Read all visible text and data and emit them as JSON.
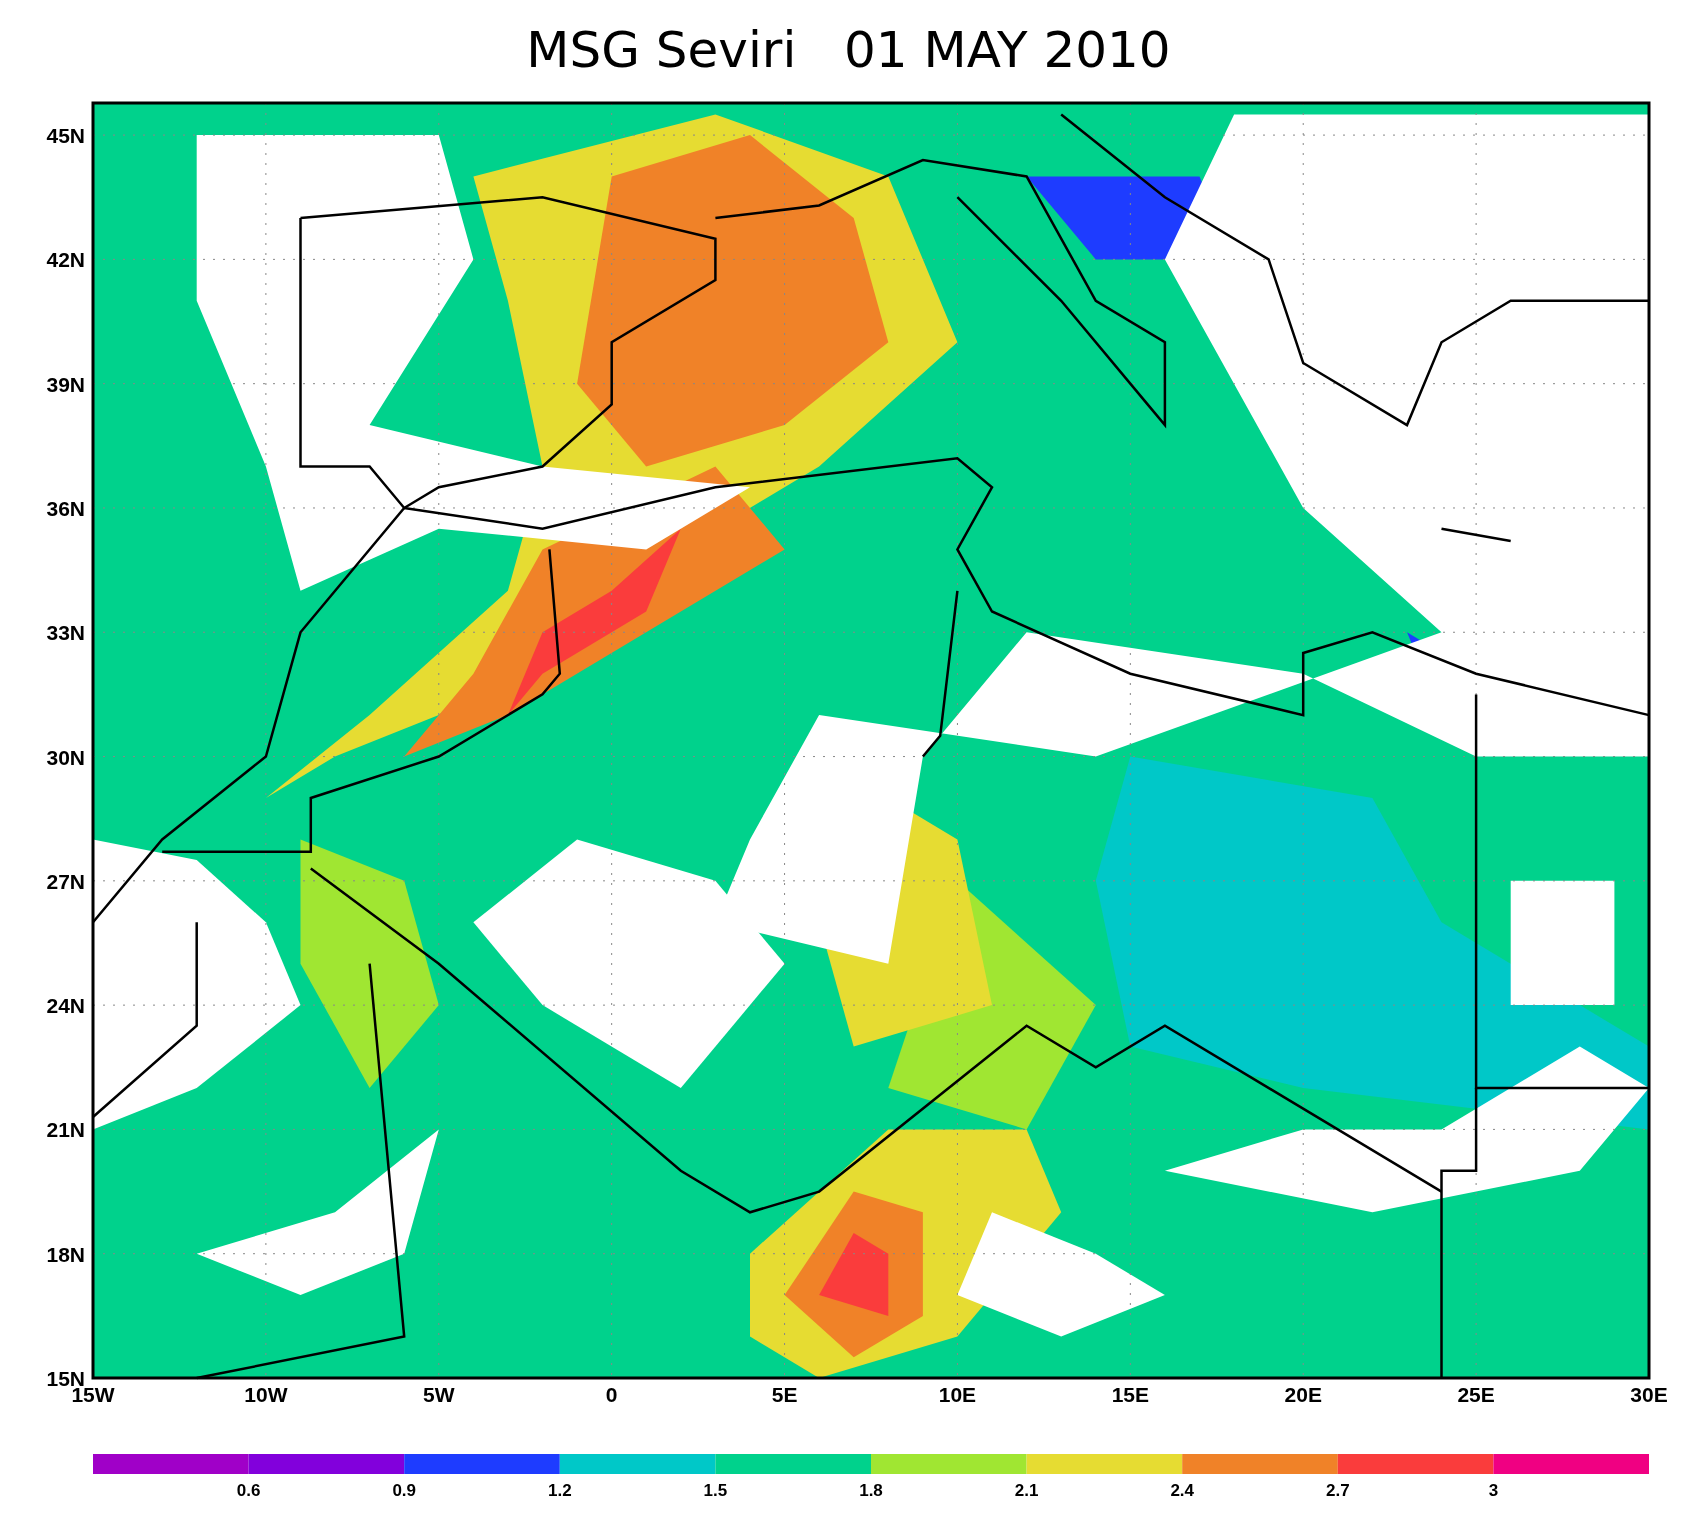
{
  "title": "MSG Seviri   01 MAY 2010",
  "y_ticks": [
    "45N",
    "42N",
    "39N",
    "36N",
    "33N",
    "30N",
    "27N",
    "24N",
    "21N",
    "18N",
    "15N"
  ],
  "x_ticks": [
    "15W",
    "10W",
    "5W",
    "0",
    "5E",
    "10E",
    "15E",
    "20E",
    "25E",
    "30E"
  ],
  "colorbar": [
    {
      "color": "#a000c8"
    },
    {
      "color": "#8200dc"
    },
    {
      "color": "#1e3cff"
    },
    {
      "color": "#00c8c8"
    },
    {
      "color": "#00d28c"
    },
    {
      "color": "#a0e632"
    },
    {
      "color": "#e6dc32"
    },
    {
      "color": "#f08228"
    },
    {
      "color": "#fa3c3c"
    },
    {
      "color": "#f00082"
    }
  ],
  "colorbar_labels": [
    "0.6",
    "0.9",
    "1.2",
    "1.5",
    "1.8",
    "2.1",
    "2.4",
    "2.7",
    "3"
  ]
}
